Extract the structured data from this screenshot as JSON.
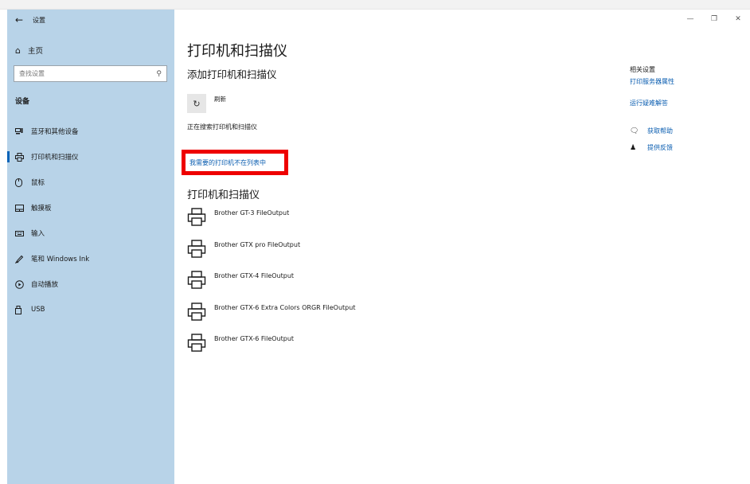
{
  "window": {
    "title": "设置"
  },
  "sidebar": {
    "home_label": "主页",
    "search_placeholder": "查找设置",
    "section_label": "设备",
    "items": [
      {
        "label": "蓝牙和其他设备",
        "icon": "bluetooth-devices-icon"
      },
      {
        "label": "打印机和扫描仪",
        "icon": "printer-icon",
        "active": true
      },
      {
        "label": "鼠标",
        "icon": "mouse-icon"
      },
      {
        "label": "触摸板",
        "icon": "touchpad-icon"
      },
      {
        "label": "输入",
        "icon": "keyboard-icon"
      },
      {
        "label": "笔和 Windows Ink",
        "icon": "pen-icon"
      },
      {
        "label": "自动播放",
        "icon": "autoplay-icon"
      },
      {
        "label": "USB",
        "icon": "usb-icon"
      }
    ]
  },
  "main": {
    "page_title": "打印机和扫描仪",
    "add_section_title": "添加打印机和扫描仪",
    "refresh_label": "刷新",
    "searching_text": "正在搜索打印机和扫描仪",
    "not_listed_link": "我需要的打印机不在列表中",
    "printers_section_title": "打印机和扫描仪",
    "printers": [
      {
        "name": "Brother GT-3 FileOutput"
      },
      {
        "name": "Brother GTX pro FileOutput"
      },
      {
        "name": "Brother GTX-4 FileOutput"
      },
      {
        "name": "Brother GTX-6 Extra Colors ORGR FileOutput"
      },
      {
        "name": "Brother GTX-6 FileOutput"
      }
    ]
  },
  "related": {
    "title": "相关设置",
    "links": [
      {
        "label": "打印服务器属性"
      },
      {
        "label": "运行疑难解答"
      }
    ],
    "help": [
      {
        "label": "获取帮助",
        "icon": "help-chat-icon"
      },
      {
        "label": "提供反馈",
        "icon": "feedback-icon"
      }
    ]
  },
  "colors": {
    "sidebar_bg": "#b8d3e8",
    "accent": "#0a5db0",
    "highlight_box": "#ee0000"
  }
}
